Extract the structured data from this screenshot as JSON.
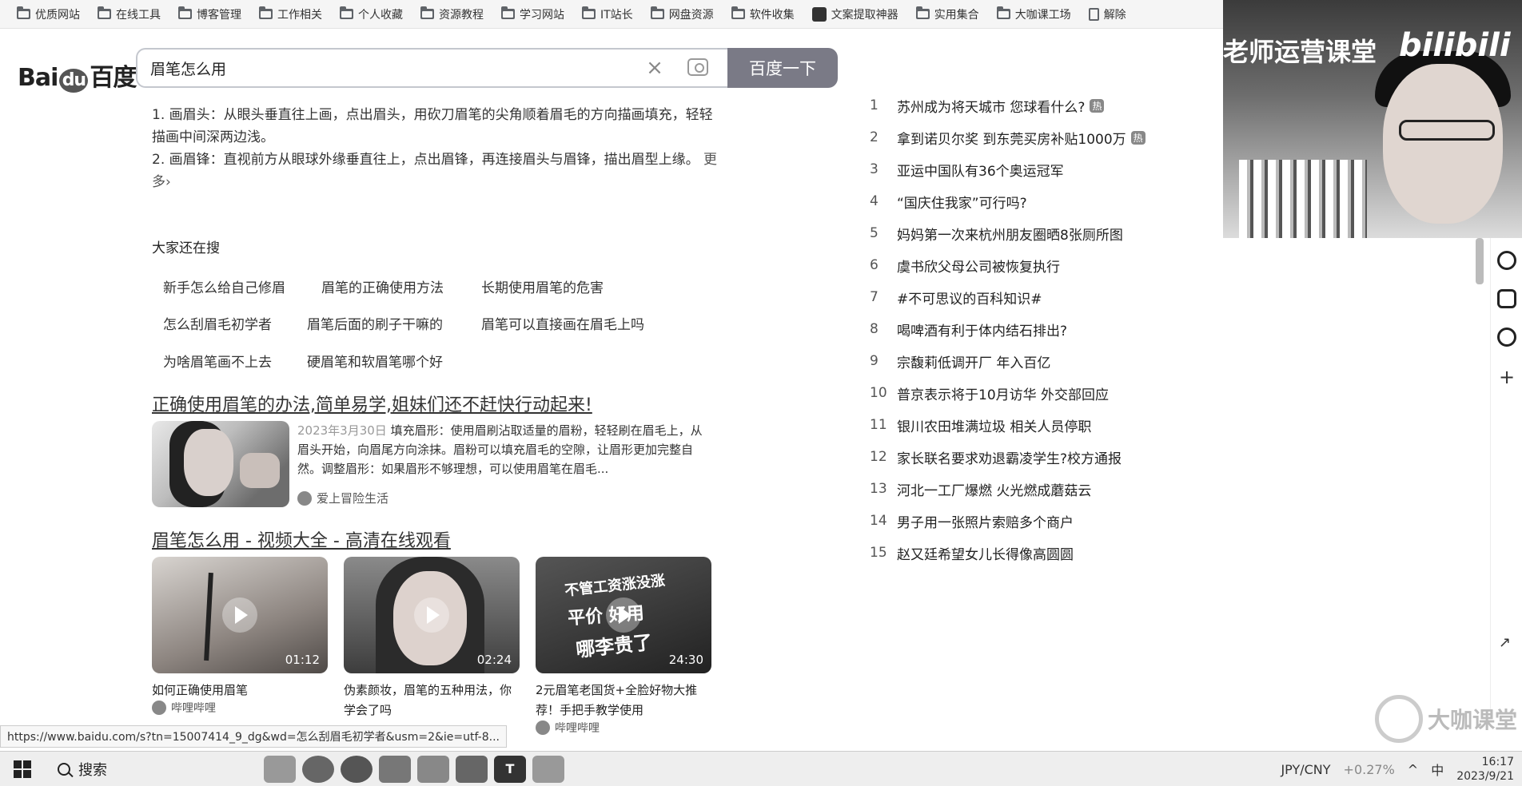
{
  "bookmarks": [
    {
      "label": "优质网站",
      "icon": "folder-icon"
    },
    {
      "label": "在线工具",
      "icon": "folder-icon"
    },
    {
      "label": "博客管理",
      "icon": "folder-icon"
    },
    {
      "label": "工作相关",
      "icon": "folder-icon"
    },
    {
      "label": "个人收藏",
      "icon": "folder-icon"
    },
    {
      "label": "资源教程",
      "icon": "folder-icon"
    },
    {
      "label": "学习网站",
      "icon": "folder-icon"
    },
    {
      "label": "IT站长",
      "icon": "folder-icon"
    },
    {
      "label": "网盘资源",
      "icon": "folder-icon"
    },
    {
      "label": "软件收集",
      "icon": "folder-icon"
    },
    {
      "label": "文案提取神器",
      "icon": "app-icon"
    },
    {
      "label": "实用集合",
      "icon": "folder-icon"
    },
    {
      "label": "大咖课工场",
      "icon": "folder-icon"
    },
    {
      "label": "解除",
      "icon": "document-icon"
    }
  ],
  "header": {
    "logo_bai": "Bai",
    "logo_du": "du",
    "logo_cn": "百度",
    "search_value": "眉笔怎么用",
    "search_button": "百度一下"
  },
  "answer": {
    "line1": "1. 画眉头：从眼头垂直往上画，点出眉头，用砍刀眉笔的尖角顺着眉毛的方向描画填充，轻轻描画中间深两边浅。",
    "line2": "2. 画眉锋：直视前方从眼球外缘垂直往上，点出眉锋，再连接眉头与眉锋，描出眉型上缘。",
    "more": "更多›"
  },
  "also_search": {
    "title": "大家还在搜",
    "items": [
      "新手怎么给自己修眉",
      "眉笔的正确使用方法",
      "长期使用眉笔的危害",
      "怎么刮眉毛初学者",
      "眉笔后面的刷子干嘛的",
      "眉笔可以直接画在眉毛上吗",
      "为啥眉笔画不上去",
      "硬眉笔和软眉笔哪个好"
    ]
  },
  "result1": {
    "title": "正确使用眉笔的办法,简单易学,姐妹们还不赶快行动起来!",
    "date": "2023年3月30日",
    "snippet": "填充眉形：使用眉刷沾取适量的眉粉，轻轻刷在眉毛上，从眉头开始，向眉尾方向涂抹。眉粉可以填充眉毛的空隙，让眉形更加完整自然。调整眉形：如果眉形不够理想，可以使用眉笔在眉毛...",
    "source": "爱上冒险生活"
  },
  "result2": {
    "title": "眉笔怎么用 - 视频大全 - 高清在线观看",
    "videos": [
      {
        "duration": "01:12",
        "caption": "如何正确使用眉笔",
        "source": "哔哩哔哩"
      },
      {
        "duration": "02:24",
        "caption": "伪素颜妆，眉笔的五种用法，你学会了吗",
        "source": ""
      },
      {
        "duration": "24:30",
        "caption": "2元眉笔老国货+全脸好物大推荐！手把手教学使用",
        "source": "哔哩哔哩",
        "overlay_top": "不管工资涨没涨",
        "overlay_mid": "平价 好用",
        "overlay_bottom": "哪李贵了"
      }
    ]
  },
  "hot_list": [
    {
      "rank": "1",
      "title": "苏州成为将天城市 您球看什么?",
      "tag": "热"
    },
    {
      "rank": "2",
      "title": "拿到诺贝尔奖 到东莞买房补贴1000万",
      "tag": "热"
    },
    {
      "rank": "3",
      "title": "亚运中国队有36个奥运冠军",
      "tag": ""
    },
    {
      "rank": "4",
      "title": "“国庆住我家”可行吗?",
      "tag": ""
    },
    {
      "rank": "5",
      "title": "妈妈第一次来杭州朋友圈晒8张厕所图",
      "tag": ""
    },
    {
      "rank": "6",
      "title": "虞书欣父母公司被恢复执行",
      "tag": ""
    },
    {
      "rank": "7",
      "title": "#不可思议的百科知识#",
      "tag": ""
    },
    {
      "rank": "8",
      "title": "喝啤酒有利于体内结石排出?",
      "tag": ""
    },
    {
      "rank": "9",
      "title": "宗馥莉低调开厂 年入百亿",
      "tag": ""
    },
    {
      "rank": "10",
      "title": "普京表示将于10月访华 外交部回应",
      "tag": ""
    },
    {
      "rank": "11",
      "title": "银川农田堆满垃圾 相关人员停职",
      "tag": ""
    },
    {
      "rank": "12",
      "title": "家长联名要求劝退霸凌学生?校方通报",
      "tag": ""
    },
    {
      "rank": "13",
      "title": "河北一工厂爆燃 火光燃成蘑菇云",
      "tag": ""
    },
    {
      "rank": "14",
      "title": "男子用一张照片索赔多个商户",
      "tag": ""
    },
    {
      "rank": "15",
      "title": "赵又廷希望女儿长得像高圆圆",
      "tag": ""
    }
  ],
  "webcam": {
    "title": "老师运营课堂",
    "brand": "bilibili"
  },
  "watermark": "大咖课堂",
  "status_url": "https://www.baidu.com/s?tn=15007414_9_dg&wd=怎么刮眉毛初学者&usm=2&ie=utf-8...",
  "taskbar": {
    "search": "搜索",
    "ticker": "JPY/CNY",
    "ticker_change": "+0.27%",
    "ime": "中",
    "time": "16:17",
    "date": "2023/9/21"
  }
}
